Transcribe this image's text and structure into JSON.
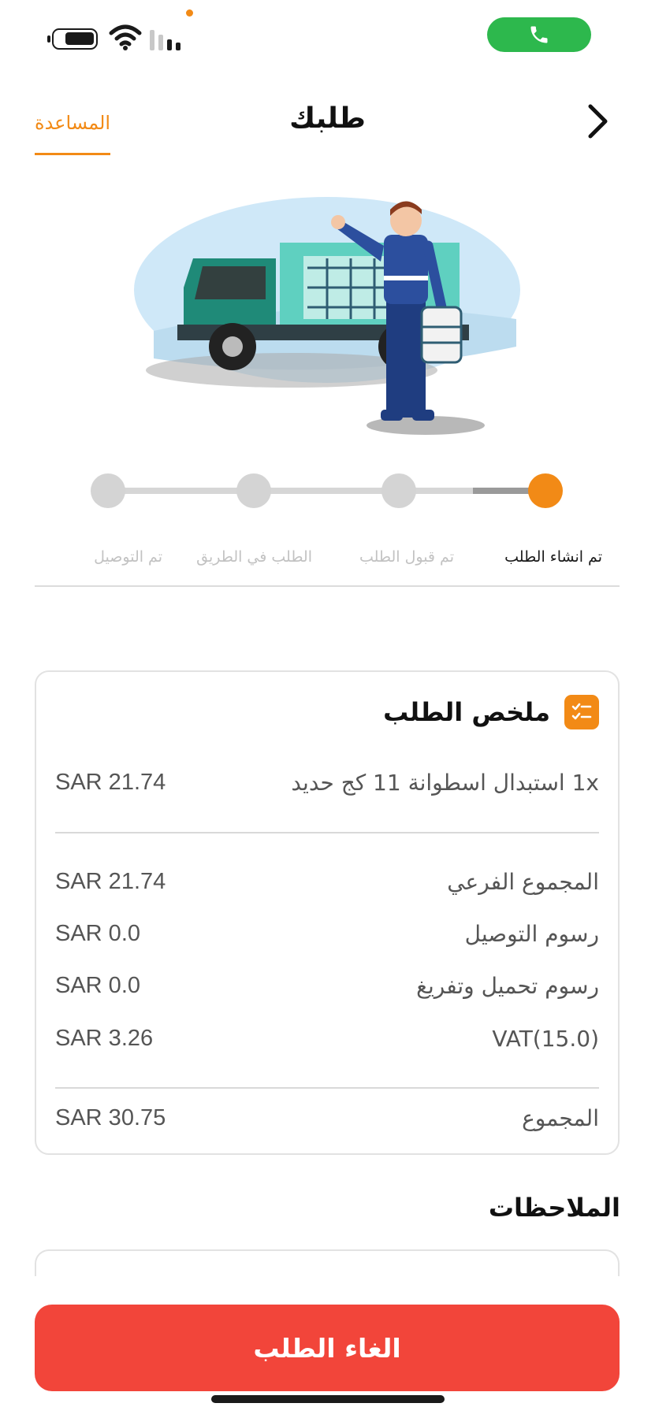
{
  "status_bar": {
    "battery_icon": "battery-icon",
    "wifi_icon": "wifi-icon",
    "signal_icon": "signal-icon",
    "call_icon": "phone-icon",
    "call_pill_color": "#2db84d"
  },
  "header": {
    "title": "طلبك",
    "help_label": "المساعدة",
    "back_icon": "chevron-right-icon"
  },
  "progress": {
    "current_step": 1,
    "steps": [
      {
        "label": "تم انشاء الطلب",
        "active": true
      },
      {
        "label": "تم قبول الطلب",
        "active": false
      },
      {
        "label": "الطلب في الطريق",
        "active": false
      },
      {
        "label": "تم التوصيل",
        "active": false
      }
    ]
  },
  "summary": {
    "title": "ملخص الطلب",
    "icon": "checklist-icon",
    "item": {
      "label": "1x استبدال اسطوانة 11 كج حديد",
      "value": "SAR 21.74"
    },
    "rows": [
      {
        "label": "المجموع الفرعي",
        "value": "SAR 21.74"
      },
      {
        "label": "رسوم التوصيل",
        "value": "SAR 0.0"
      },
      {
        "label": "رسوم تحميل وتفريغ",
        "value": "SAR 0.0"
      },
      {
        "label": "VAT(15.0)",
        "value": "SAR 3.26"
      }
    ],
    "total": {
      "label": "المجموع",
      "value": "SAR 30.75"
    }
  },
  "notes": {
    "title": "الملاحظات"
  },
  "cancel_button": {
    "label": "الغاء الطلب"
  },
  "colors": {
    "accent": "#f28a16",
    "danger": "#f2453a",
    "truck": "#1f8a78",
    "sky": "#cfe8f8"
  }
}
